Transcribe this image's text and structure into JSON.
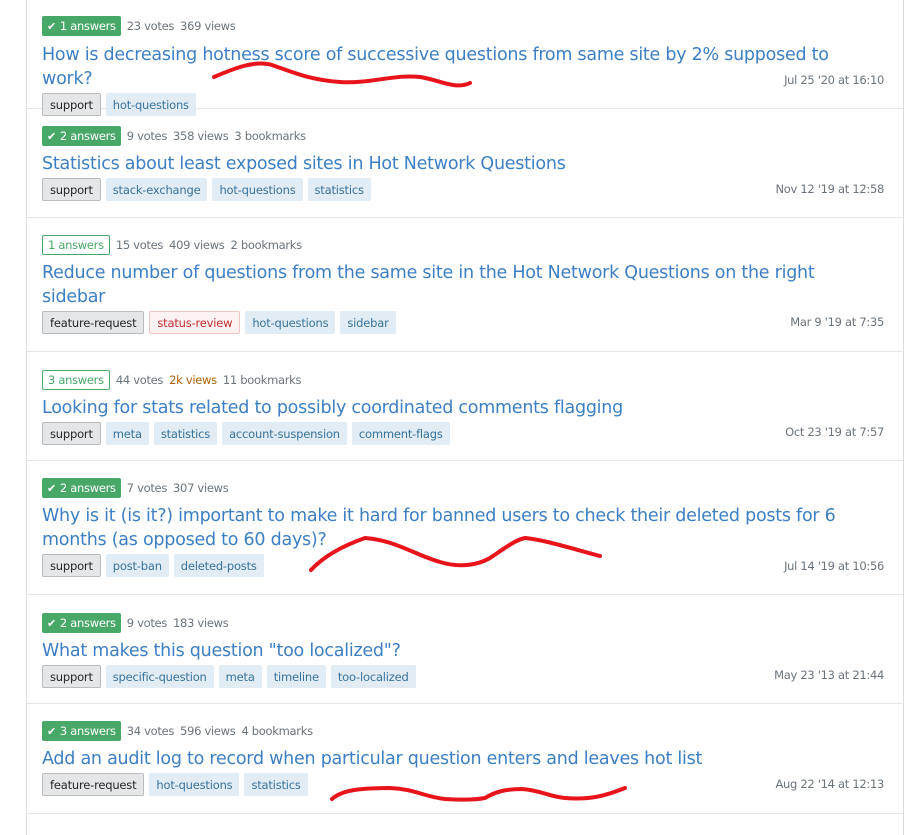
{
  "questions": [
    {
      "answers_label": "1 answers",
      "accepted": true,
      "votes": "23 votes",
      "views": "369 views",
      "views_hot": false,
      "bookmarks": "",
      "title": "How is decreasing hotness score of successive questions from same site by 2% supposed to work?",
      "tags": [
        {
          "label": "support",
          "kind": "req"
        },
        {
          "label": "hot-questions",
          "kind": "normal"
        }
      ],
      "date": "Jul 25 '20 at 16:10"
    },
    {
      "answers_label": "2 answers",
      "accepted": true,
      "votes": "9 votes",
      "views": "358 views",
      "views_hot": false,
      "bookmarks": "3 bookmarks",
      "title": "Statistics about least exposed sites in Hot Network Questions",
      "tags": [
        {
          "label": "support",
          "kind": "req"
        },
        {
          "label": "stack-exchange",
          "kind": "normal"
        },
        {
          "label": "hot-questions",
          "kind": "normal"
        },
        {
          "label": "statistics",
          "kind": "normal"
        }
      ],
      "date": "Nov 12 '19 at 12:58"
    },
    {
      "answers_label": "1 answers",
      "accepted": false,
      "votes": "15 votes",
      "views": "409 views",
      "views_hot": false,
      "bookmarks": "2 bookmarks",
      "title": "Reduce number of questions from the same site in the Hot Network Questions on the right sidebar",
      "tags": [
        {
          "label": "feature-request",
          "kind": "req"
        },
        {
          "label": "status-review",
          "kind": "mod"
        },
        {
          "label": "hot-questions",
          "kind": "normal"
        },
        {
          "label": "sidebar",
          "kind": "normal"
        }
      ],
      "date": "Mar 9 '19 at 7:35"
    },
    {
      "answers_label": "3 answers",
      "accepted": false,
      "votes": "44 votes",
      "views": "2k views",
      "views_hot": true,
      "bookmarks": "11 bookmarks",
      "title": "Looking for stats related to possibly coordinated comments flagging",
      "tags": [
        {
          "label": "support",
          "kind": "req"
        },
        {
          "label": "meta",
          "kind": "normal"
        },
        {
          "label": "statistics",
          "kind": "normal"
        },
        {
          "label": "account-suspension",
          "kind": "normal"
        },
        {
          "label": "comment-flags",
          "kind": "normal"
        }
      ],
      "date": "Oct 23 '19 at 7:57"
    },
    {
      "answers_label": "2 answers",
      "accepted": true,
      "votes": "7 votes",
      "views": "307 views",
      "views_hot": false,
      "bookmarks": "",
      "title": "Why is it (is it?) important to make it hard for banned users to check their deleted posts for 6 months (as opposed to 60 days)?",
      "tags": [
        {
          "label": "support",
          "kind": "req"
        },
        {
          "label": "post-ban",
          "kind": "normal"
        },
        {
          "label": "deleted-posts",
          "kind": "normal"
        }
      ],
      "date": "Jul 14 '19 at 10:56"
    },
    {
      "answers_label": "2 answers",
      "accepted": true,
      "votes": "9 votes",
      "views": "183 views",
      "views_hot": false,
      "bookmarks": "",
      "title": "What makes this question \"too localized\"?",
      "tags": [
        {
          "label": "support",
          "kind": "req"
        },
        {
          "label": "specific-question",
          "kind": "normal"
        },
        {
          "label": "meta",
          "kind": "normal"
        },
        {
          "label": "timeline",
          "kind": "normal"
        },
        {
          "label": "too-localized",
          "kind": "normal"
        }
      ],
      "date": "May 23 '13 at 21:44"
    },
    {
      "answers_label": "3 answers",
      "accepted": true,
      "votes": "34 votes",
      "views": "596 views",
      "views_hot": false,
      "bookmarks": "4 bookmarks",
      "title": "Add an audit log to record when particular question enters and leaves hot list",
      "tags": [
        {
          "label": "feature-request",
          "kind": "req"
        },
        {
          "label": "hot-questions",
          "kind": "normal"
        },
        {
          "label": "statistics",
          "kind": "normal"
        }
      ],
      "date": "Aug 22 '14 at 12:13"
    }
  ],
  "icons": {
    "accepted": "check-icon"
  },
  "colors": {
    "accent_green": "#48a868",
    "link_blue": "#3d7fc4",
    "annotation_red": "#e8141c"
  }
}
